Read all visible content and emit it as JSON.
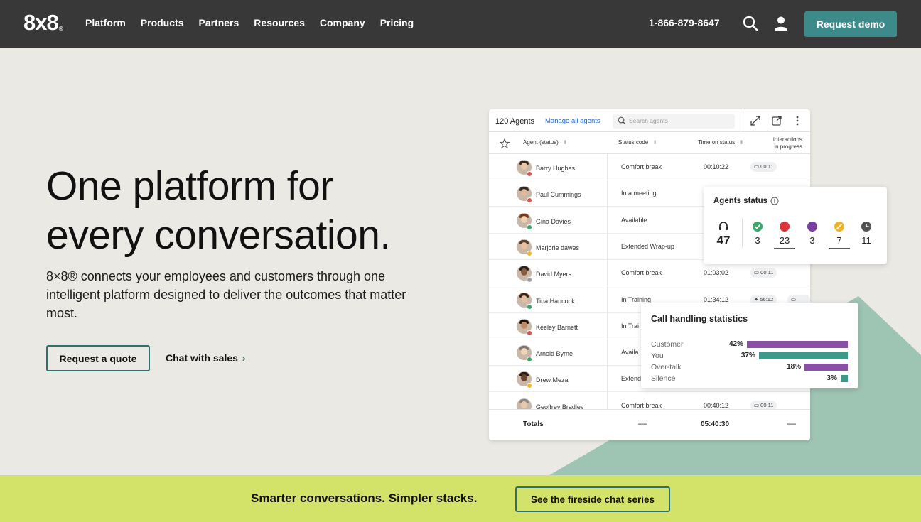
{
  "nav": {
    "logo": "8x8",
    "logo_mark": "®",
    "links": [
      "Platform",
      "Products",
      "Partners",
      "Resources",
      "Company",
      "Pricing"
    ],
    "phone": "1-866-879-8647",
    "demo_label": "Request demo"
  },
  "hero": {
    "title_line1": "One platform for",
    "title_line2": "every conversation.",
    "subtitle": "8×8® connects your employees and customers through one intelligent platform designed to deliver the outcomes that matter most.",
    "quote_label": "Request a quote",
    "chat_label": "Chat with sales",
    "chat_chevron": "›"
  },
  "agents_panel": {
    "count": "120 Agents",
    "manage": "Manage all agents",
    "search_placeholder": "Search agents",
    "col_agent": "Agent (status)",
    "col_code": "Status code",
    "col_time": "Time on status",
    "col_interactions_1": "interactions",
    "col_interactions_2": "in progress",
    "sort_glyph": "⬍",
    "rows": [
      {
        "name": "Barry Hughes",
        "code": "Comfort break",
        "time": "00:10:22",
        "chip": "00:11",
        "dot": "#d9534f"
      },
      {
        "name": "Paul Cummings",
        "code": "In a meeting",
        "time": "",
        "chip": "",
        "dot": "#d9534f"
      },
      {
        "name": "Gina Davies",
        "code": "Available",
        "time": "",
        "chip": "",
        "dot": "#3aa56a"
      },
      {
        "name": "Marjorie dawes",
        "code": "Extended Wrap-up",
        "time": "",
        "chip": "",
        "dot": "#f0b429"
      },
      {
        "name": "David Myers",
        "code": "Comfort break",
        "time": "01:03:02",
        "chip": "00:11",
        "dot": "#9aa0a6"
      },
      {
        "name": "Tina Hancock",
        "code": "In Training",
        "time": "01:34:12",
        "chip": "56:12",
        "chip2": "00:1",
        "dot": "#3aa56a"
      },
      {
        "name": "Keeley Barnett",
        "code": "In Trai",
        "time": "",
        "chip": "",
        "dot": "#d9534f"
      },
      {
        "name": "Arnold Byrne",
        "code": "Availa",
        "time": "",
        "chip": "",
        "dot": "#3aa56a"
      },
      {
        "name": "Drew Meza",
        "code": "Extend",
        "time": "",
        "chip": "",
        "dot": "#f0b429"
      },
      {
        "name": "Geoffrey Bradley",
        "code": "Comfort break",
        "time": "00:40:12",
        "chip": "00:11",
        "dot": "#9aa0a6"
      }
    ],
    "totals_label": "Totals",
    "totals_dash": "—",
    "totals_time": "05:40:30"
  },
  "agents_status": {
    "title": "Agents status",
    "items": [
      {
        "icon": "headset-icon",
        "value": "47",
        "color": "#222222"
      },
      {
        "icon": "available-icon",
        "value": "3",
        "color": "#3aa56a"
      },
      {
        "icon": "busy-icon",
        "value": "23",
        "color": "#d9343a"
      },
      {
        "icon": "away-icon",
        "value": "3",
        "color": "#7a3ea0"
      },
      {
        "icon": "wrapup-icon",
        "value": "7",
        "color": "#f0b429"
      },
      {
        "icon": "clock-icon",
        "value": "11",
        "color": "#555555"
      }
    ]
  },
  "call_stats": {
    "title": "Call handling statistics",
    "items": [
      {
        "label": "Customer",
        "percent": 42,
        "pct_text": "42%",
        "color": "#8a4fa6"
      },
      {
        "label": "You",
        "percent": 37,
        "pct_text": "37%",
        "color": "#3d9a8a"
      },
      {
        "label": "Over-talk",
        "percent": 18,
        "pct_text": "18%",
        "color": "#8a4fa6"
      },
      {
        "label": "Silence",
        "percent": 3,
        "pct_text": "3%",
        "color": "#3d9a8a"
      }
    ]
  },
  "banner": {
    "text": "Smarter conversations. Simpler stacks.",
    "button": "See the fireside chat series"
  },
  "colors": {
    "nav_bg": "#383838",
    "accent": "#3d8a8a",
    "banner_bg": "#d3e36a",
    "shape": "#9ec4b4"
  }
}
